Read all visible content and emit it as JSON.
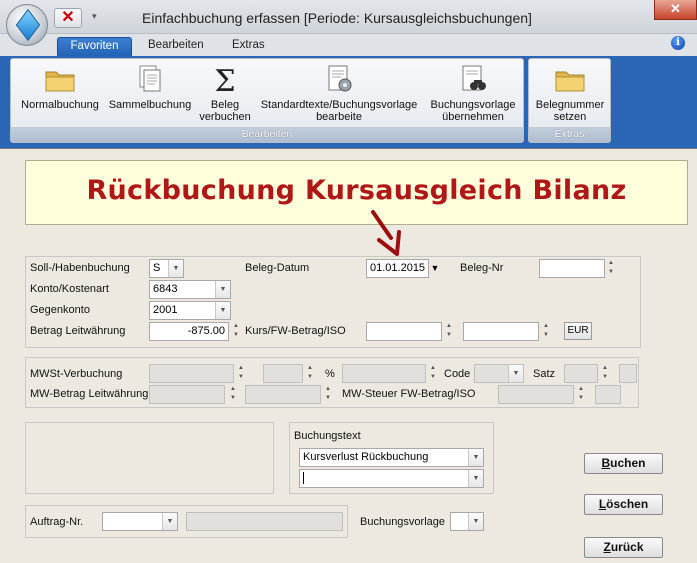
{
  "window": {
    "title": "Einfachbuchung erfassen  [Periode: Kursausgleichsbuchungen]",
    "close_glyph": "✕",
    "quick_access_close_glyph": "✕",
    "quick_access_dropdown_glyph": "▾",
    "help_glyph": "i"
  },
  "tabs": [
    {
      "label": "Favoriten",
      "active": true
    },
    {
      "label": "Bearbeiten",
      "active": false
    },
    {
      "label": "Extras",
      "active": false
    }
  ],
  "ribbon": {
    "groups": [
      {
        "label": "Bearbeiten",
        "buttons": [
          {
            "label": "Normalbuchung",
            "icon": "folder-icon"
          },
          {
            "label": "Sammelbuchung",
            "icon": "documents-icon"
          },
          {
            "label_line1": "Beleg",
            "label_line2": "verbuchen",
            "icon": "sigma-icon"
          },
          {
            "label_line1": "Standardtexte/Buchungsvorlage",
            "label_line2": "bearbeite",
            "icon": "document-gear-icon"
          },
          {
            "label_line1": "Buchungsvorlage",
            "label_line2": "übernehmen",
            "icon": "document-binoculars-icon"
          }
        ]
      },
      {
        "label": "Extras",
        "buttons": [
          {
            "label_line1": "Belegnummer",
            "label_line2": "setzen",
            "icon": "folder-icon"
          }
        ]
      }
    ]
  },
  "banner": {
    "title": "Rückbuchung Kursausgleich Bilanz",
    "color": "#b01818"
  },
  "form": {
    "soll_haben": {
      "label": "Soll-/Habenbuchung",
      "value": "S"
    },
    "beleg_datum": {
      "label": "Beleg-Datum",
      "value": "01.01.2015"
    },
    "beleg_nr": {
      "label": "Beleg-Nr",
      "value": ""
    },
    "konto": {
      "label": "Konto/Kostenart",
      "value": "6843"
    },
    "gegenkonto": {
      "label": "Gegenkonto",
      "value": "2001"
    },
    "betrag": {
      "label": "Betrag Leitwährung",
      "value": "-875.00"
    },
    "kurs": {
      "label": "Kurs/FW-Betrag/ISO",
      "value1": "",
      "value2": "",
      "currency_button": "EUR"
    },
    "mwst": {
      "label": "MWSt-Verbuchung",
      "percent_label": "%",
      "code_label": "Code",
      "satz_label": "Satz"
    },
    "mw_betrag": {
      "label": "MW-Betrag Leitwährung",
      "fw_label": "MW-Steuer FW-Betrag/ISO"
    },
    "buchungstext": {
      "label": "Buchungstext",
      "value1": "Kursverlust Rückbuchung",
      "value2": ""
    },
    "auftrag": {
      "label": "Auftrag-Nr.",
      "value": ""
    },
    "buchungsvorlage": {
      "label": "Buchungsvorlage",
      "value": ""
    }
  },
  "buttons": {
    "buchen": {
      "prefix": "B",
      "rest": "uchen"
    },
    "loeschen": {
      "prefix": "L",
      "rest": "öschen"
    },
    "zurueck": {
      "prefix": "Z",
      "rest": "urück"
    }
  }
}
